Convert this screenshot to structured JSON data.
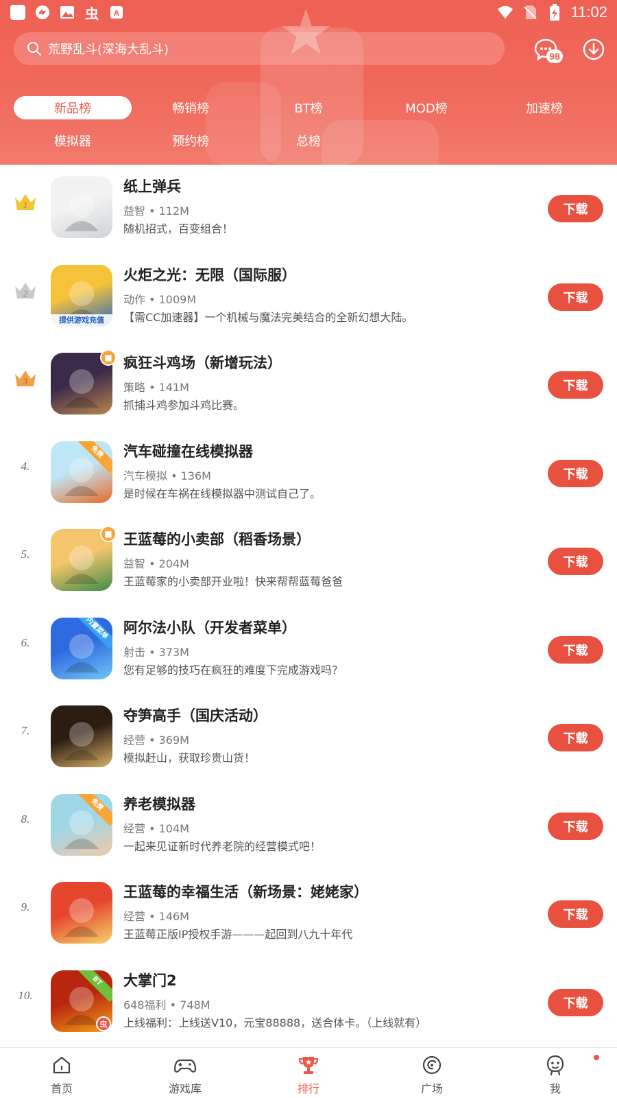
{
  "status_bar": {
    "time": "11:02"
  },
  "search": {
    "placeholder": "荒野乱斗(深海大乱斗)"
  },
  "messages": {
    "badge_count": "98"
  },
  "tabs": [
    {
      "label": "新品榜",
      "active": true
    },
    {
      "label": "畅销榜",
      "active": false
    },
    {
      "label": "BT榜",
      "active": false
    },
    {
      "label": "MOD榜",
      "active": false
    },
    {
      "label": "加速榜",
      "active": false
    },
    {
      "label": "模拟器",
      "active": false
    },
    {
      "label": "预约榜",
      "active": false
    },
    {
      "label": "总榜",
      "active": false
    }
  ],
  "download_label": "下载",
  "games": [
    {
      "rank": "1",
      "rank_style": "gold-crown",
      "title": "纸上弹兵",
      "meta": "益智 • 112M",
      "desc": "随机招式，百变组合！",
      "icon_name": "stickman-ninja-icon",
      "icon_colors": [
        "#f2f2f2",
        "#cfd4d8"
      ],
      "icon_tag": ""
    },
    {
      "rank": "2",
      "rank_style": "silver-crown",
      "title": "火炬之光：无限（国际服）",
      "meta": "动作 • 1009M",
      "desc": "【需CC加速器】一个机械与魔法完美结合的全新幻想大陆。",
      "icon_name": "torchlight-icon",
      "icon_colors": [
        "#f6c23a",
        "#2a67c4"
      ],
      "icon_tag": "提供游戏充值"
    },
    {
      "rank": "3",
      "rank_style": "bronze-crown",
      "title": "疯狂斗鸡场（新增玩法）",
      "meta": "策略 • 141M",
      "desc": "抓捕斗鸡参加斗鸡比赛。",
      "icon_name": "rooster-fight-icon",
      "icon_colors": [
        "#3c2a4a",
        "#b8864e"
      ],
      "icon_tag": ""
    },
    {
      "rank": "4.",
      "rank_style": "number",
      "title": "汽车碰撞在线模拟器",
      "meta": "汽车模拟 • 136M",
      "desc": "是时候在车祸在线模拟器中测试自己了。",
      "icon_name": "car-crash-icon",
      "icon_colors": [
        "#bfe6f6",
        "#e86a2a"
      ],
      "icon_tag": "免费"
    },
    {
      "rank": "5.",
      "rank_style": "number",
      "title": "王蓝莓的小卖部（稻香场景）",
      "meta": "益智 • 204M",
      "desc": "王蓝莓家的小卖部开业啦！快来帮帮蓝莓爸爸",
      "icon_name": "shopkeeper-icon",
      "icon_colors": [
        "#f4c56b",
        "#3e8b4a"
      ],
      "icon_tag": ""
    },
    {
      "rank": "6.",
      "rank_style": "number",
      "title": "阿尔法小队（开发者菜单）",
      "meta": "射击 • 373M",
      "desc": "您有足够的技巧在疯狂的难度下完成游戏吗？",
      "icon_name": "alpha-squad-icon",
      "icon_colors": [
        "#2f6be0",
        "#6fc6f5"
      ],
      "icon_tag": "内置菜单"
    },
    {
      "rank": "7.",
      "rank_style": "number",
      "title": "夺笋高手（国庆活动）",
      "meta": "经营 • 369M",
      "desc": "模拟赶山，获取珍贵山货！",
      "icon_name": "ginseng-root-icon",
      "icon_colors": [
        "#2b1d12",
        "#d9b06a"
      ],
      "icon_tag": ""
    },
    {
      "rank": "8.",
      "rank_style": "number",
      "title": "养老模拟器",
      "meta": "经营 • 104M",
      "desc": "一起来见证新时代养老院的经营模式吧！",
      "icon_name": "grandma-icon",
      "icon_colors": [
        "#9fd6e8",
        "#f0c9a8"
      ],
      "icon_tag": "免费"
    },
    {
      "rank": "9.",
      "rank_style": "number",
      "title": "王蓝莓的幸福生活（新场景：姥姥家）",
      "meta": "经营 • 146M",
      "desc": "王蓝莓正版IP授权手游———起回到八九十年代",
      "icon_name": "happy-life-icon",
      "icon_colors": [
        "#e7462e",
        "#f6d46a"
      ],
      "icon_tag": ""
    },
    {
      "rank": "10.",
      "rank_style": "number",
      "title": "大掌门2",
      "meta": "648福利 • 748M",
      "desc": "上线福利：上线送V10，元宝88888，送合体卡。（上线就有）",
      "icon_name": "grand-master-icon",
      "icon_colors": [
        "#b8260f",
        "#f5a21a"
      ],
      "icon_tag": "BT"
    }
  ],
  "bottom_nav": [
    {
      "label": "首页",
      "icon": "home-icon",
      "active": false
    },
    {
      "label": "游戏库",
      "icon": "gamepad-icon",
      "active": false
    },
    {
      "label": "排行",
      "icon": "trophy-icon",
      "active": true
    },
    {
      "label": "广场",
      "icon": "plaza-icon",
      "active": false
    },
    {
      "label": "我",
      "icon": "profile-icon",
      "active": false
    }
  ],
  "colors": {
    "brand_red": "#ef5446",
    "header_red": "#ef6054",
    "gold": "#f5c431",
    "silver": "#c9c9c9",
    "bronze": "#f0a04b"
  }
}
